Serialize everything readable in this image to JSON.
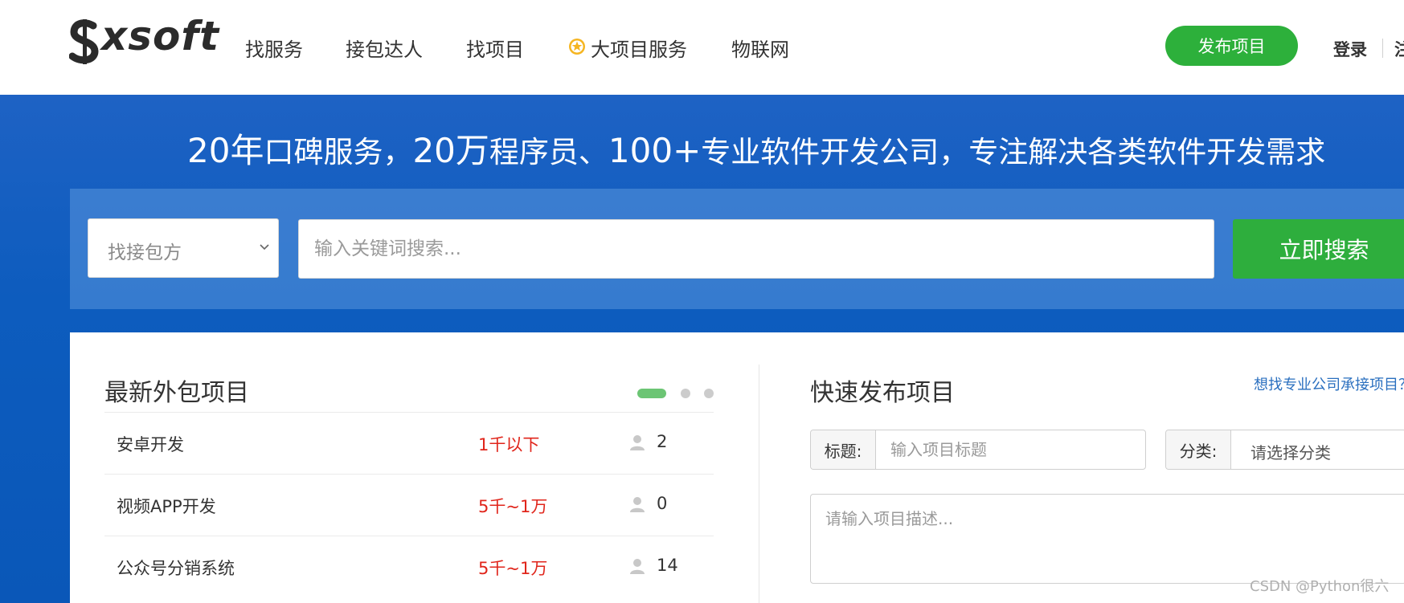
{
  "brand": {
    "logo_text": "xsoft"
  },
  "nav": {
    "items": [
      "找服务",
      "接包达人",
      "找项目",
      "大项目服务",
      "物联网"
    ]
  },
  "header": {
    "publish_label": "发布项目",
    "login_label": "登录",
    "register_label": "注"
  },
  "banner": {
    "headline": {
      "part1": "20年",
      "part2": "口碑服务，",
      "part3": "20万",
      "part4": "程序员、",
      "part5": "100+",
      "part6": "专业软件开发公司，专注解决各类软件开发需求"
    },
    "search": {
      "select_value": "找接包方",
      "input_placeholder": "输入关键词搜索...",
      "button_label": "立即搜索"
    }
  },
  "projects": {
    "title": "最新外包项目",
    "items": [
      {
        "name": "安卓开发",
        "budget": "1千以下",
        "count": "2"
      },
      {
        "name": "视频APP开发",
        "budget": "5千~1万",
        "count": "0"
      },
      {
        "name": "公众号分销系统",
        "budget": "5千~1万",
        "count": "14"
      }
    ]
  },
  "quick_publish": {
    "title": "快速发布项目",
    "hint_link": "想找专业公司承接项目？",
    "title_label": "标题:",
    "title_placeholder": "输入项目标题",
    "category_label": "分类:",
    "category_value": "请选择分类",
    "desc_placeholder": "请输入项目描述..."
  },
  "watermark": "CSDN @Python很六",
  "colors": {
    "brand_green": "#2db03b",
    "banner_blue": "#0d5cbe",
    "budget_red": "#e0251b",
    "link_blue": "#2a6fbf"
  }
}
